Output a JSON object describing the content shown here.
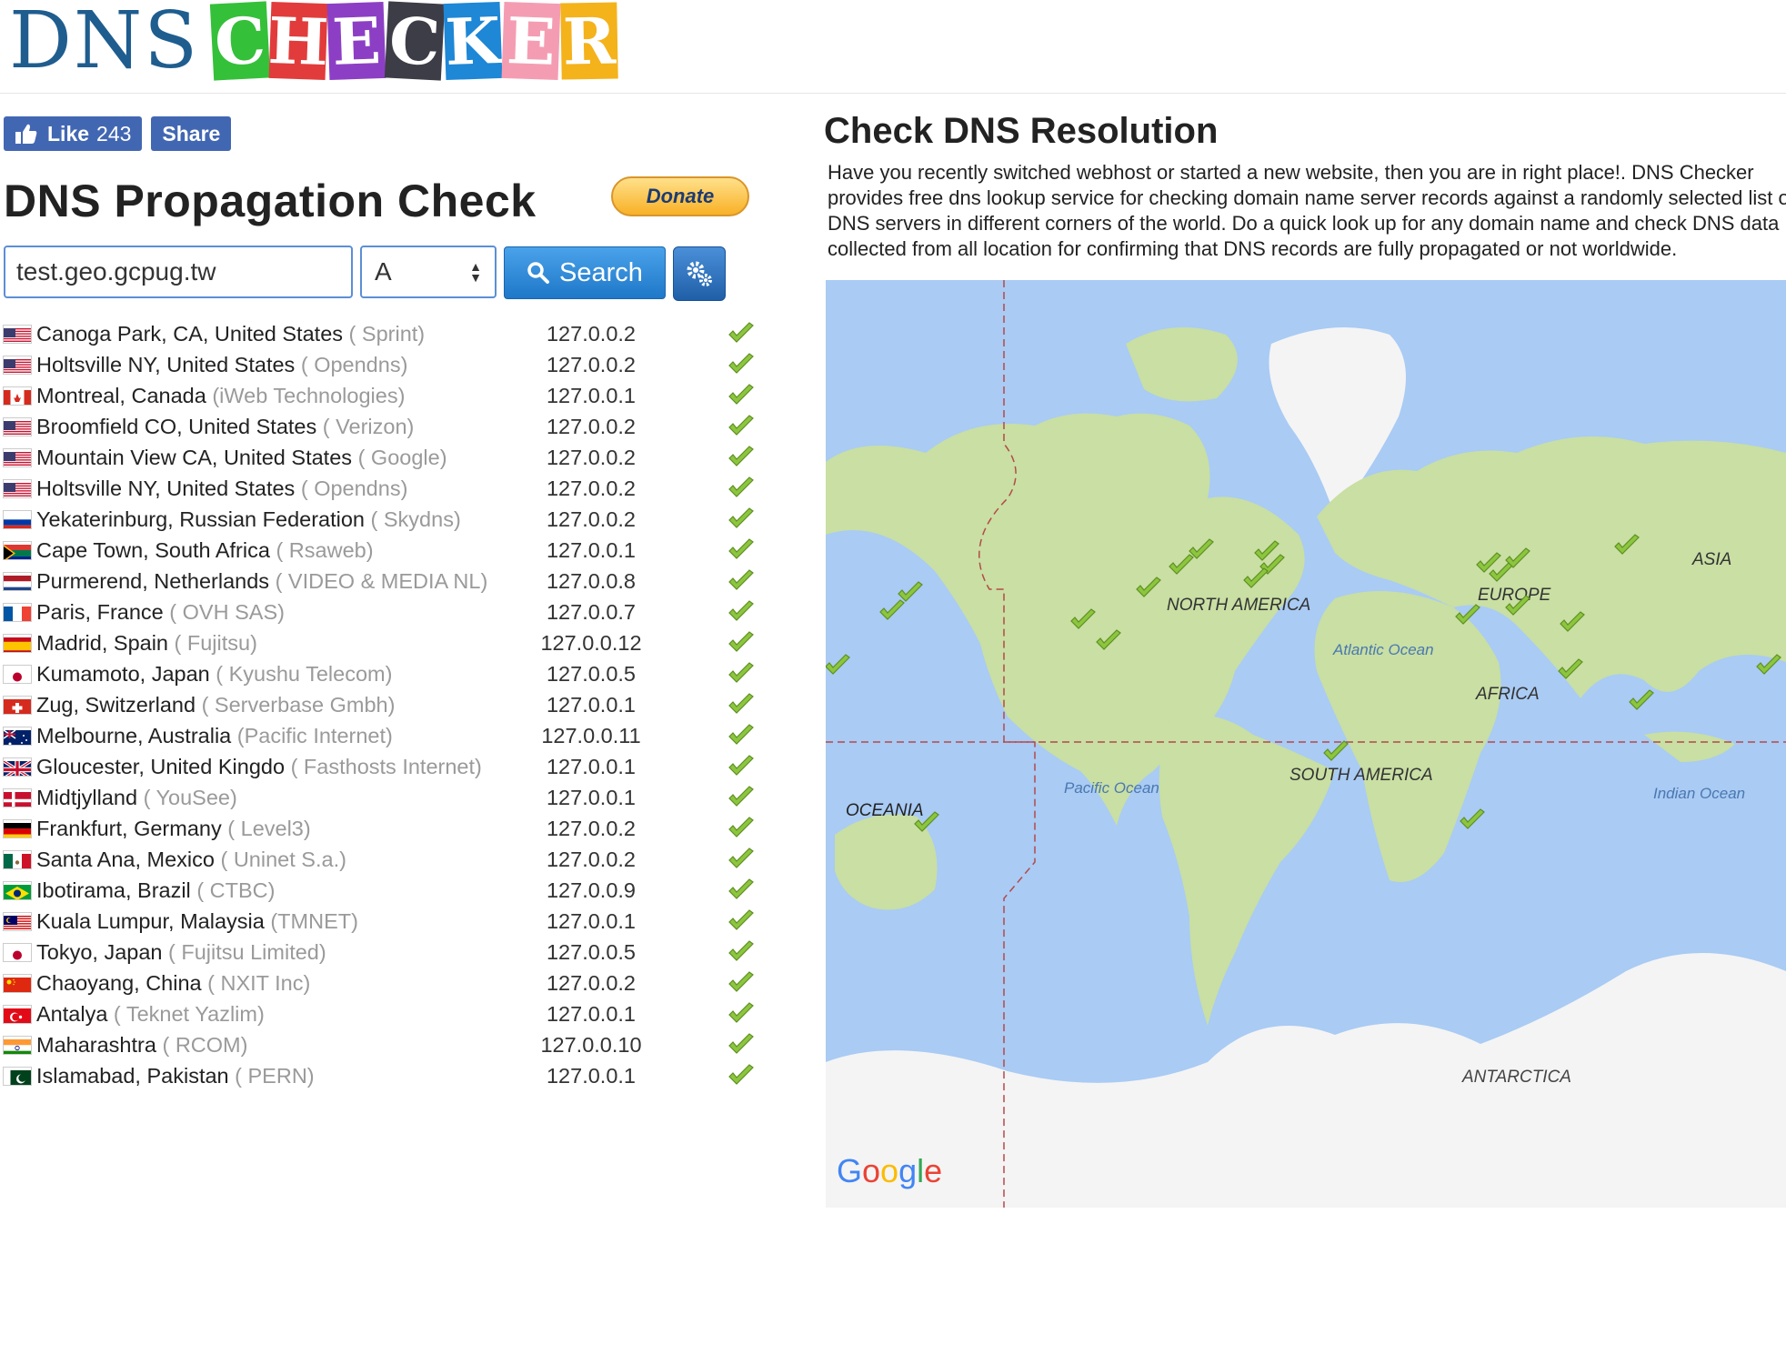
{
  "logo": {
    "prefix": "DNS",
    "letters": [
      {
        "ch": "C",
        "bg": "#35c03a"
      },
      {
        "ch": "H",
        "bg": "#e23b3b"
      },
      {
        "ch": "E",
        "bg": "#8c3fc4"
      },
      {
        "ch": "C",
        "bg": "#3d3d47"
      },
      {
        "ch": "K",
        "bg": "#1e87d6"
      },
      {
        "ch": "E",
        "bg": "#f49db2"
      },
      {
        "ch": "R",
        "bg": "#f4b21b"
      }
    ]
  },
  "social": {
    "like_label": "Like",
    "like_count": "243",
    "share_label": "Share"
  },
  "page_title": "DNS Propagation Check",
  "donate_label": "Donate",
  "search": {
    "domain_value": "test.geo.gcpug.tw",
    "record_type": "A",
    "button_label": "Search"
  },
  "results": [
    {
      "flag": "us",
      "city": "Canoga Park, CA, United States",
      "isp": "( Sprint)",
      "ip": "127.0.0.2"
    },
    {
      "flag": "us",
      "city": "Holtsville NY, United States",
      "isp": "( Opendns)",
      "ip": "127.0.0.2"
    },
    {
      "flag": "ca",
      "city": "Montreal, Canada",
      "isp": "(iWeb Technologies)",
      "ip": "127.0.0.1"
    },
    {
      "flag": "us",
      "city": "Broomfield CO, United States",
      "isp": "( Verizon)",
      "ip": "127.0.0.2"
    },
    {
      "flag": "us",
      "city": "Mountain View CA, United States",
      "isp": "( Google)",
      "ip": "127.0.0.2"
    },
    {
      "flag": "us",
      "city": "Holtsville NY, United States",
      "isp": "( Opendns)",
      "ip": "127.0.0.2"
    },
    {
      "flag": "ru",
      "city": "Yekaterinburg, Russian Federation",
      "isp": "( Skydns)",
      "ip": "127.0.0.2"
    },
    {
      "flag": "za",
      "city": "Cape Town, South Africa",
      "isp": "( Rsaweb)",
      "ip": "127.0.0.1"
    },
    {
      "flag": "nl",
      "city": "Purmerend, Netherlands",
      "isp": "( VIDEO & MEDIA NL)",
      "ip": "127.0.0.8"
    },
    {
      "flag": "fr",
      "city": "Paris, France",
      "isp": "( OVH SAS)",
      "ip": "127.0.0.7"
    },
    {
      "flag": "es",
      "city": "Madrid, Spain",
      "isp": "( Fujitsu)",
      "ip": "127.0.0.12"
    },
    {
      "flag": "jp",
      "city": "Kumamoto, Japan",
      "isp": "( Kyushu Telecom)",
      "ip": "127.0.0.5"
    },
    {
      "flag": "ch",
      "city": "Zug, Switzerland",
      "isp": "( Serverbase Gmbh)",
      "ip": "127.0.0.1"
    },
    {
      "flag": "au",
      "city": "Melbourne, Australia",
      "isp": "(Pacific Internet)",
      "ip": "127.0.0.11"
    },
    {
      "flag": "gb",
      "city": "Gloucester, United Kingdo",
      "isp": "( Fasthosts Internet)",
      "ip": "127.0.0.1"
    },
    {
      "flag": "dk",
      "city": "Midtjylland",
      "isp": "( YouSee)",
      "ip": "127.0.0.1"
    },
    {
      "flag": "de",
      "city": "Frankfurt, Germany",
      "isp": "( Level3)",
      "ip": "127.0.0.2"
    },
    {
      "flag": "mx",
      "city": "Santa Ana, Mexico",
      "isp": "( Uninet S.a.)",
      "ip": "127.0.0.2"
    },
    {
      "flag": "br",
      "city": "Ibotirama, Brazil",
      "isp": "( CTBC)",
      "ip": "127.0.0.9"
    },
    {
      "flag": "my",
      "city": "Kuala Lumpur, Malaysia",
      "isp": "(TMNET)",
      "ip": "127.0.0.1"
    },
    {
      "flag": "jp",
      "city": "Tokyo, Japan",
      "isp": "( Fujitsu Limited)",
      "ip": "127.0.0.5"
    },
    {
      "flag": "cn",
      "city": "Chaoyang, China",
      "isp": "( NXIT Inc)",
      "ip": "127.0.0.2"
    },
    {
      "flag": "tr",
      "city": "Antalya",
      "isp": "( Teknet Yazlim)",
      "ip": "127.0.0.1"
    },
    {
      "flag": "in",
      "city": "Maharashtra",
      "isp": "( RCOM)",
      "ip": "127.0.0.10"
    },
    {
      "flag": "pk",
      "city": "Islamabad, Pakistan",
      "isp": "( PERN)",
      "ip": "127.0.0.1"
    }
  ],
  "resolution_title": "Check DNS Resolution",
  "description": "Have you recently switched webhost or started a new website, then you are in right place!. DNS Checker provides free dns lookup service for checking domain name server records against a randomly selected list of DNS servers in different corners of the world. Do a quick look up for any domain name and check DNS data collected from all location for confirming that DNS records are fully propagated or not worldwide.",
  "map": {
    "labels": [
      "NORTH AMERICA",
      "EUROPE",
      "ASIA",
      "AFRICA",
      "SOUTH AMERICA",
      "OCEANIA",
      "ANTARCTICA",
      "Atlantic Ocean",
      "Pacific Ocean",
      "Indian Ocean"
    ],
    "brand": "Google",
    "colors": {
      "water": "#a9cbf4",
      "land": "#c9dfa3",
      "ice": "#f4f4f4",
      "marker": "#8cc63f"
    }
  }
}
